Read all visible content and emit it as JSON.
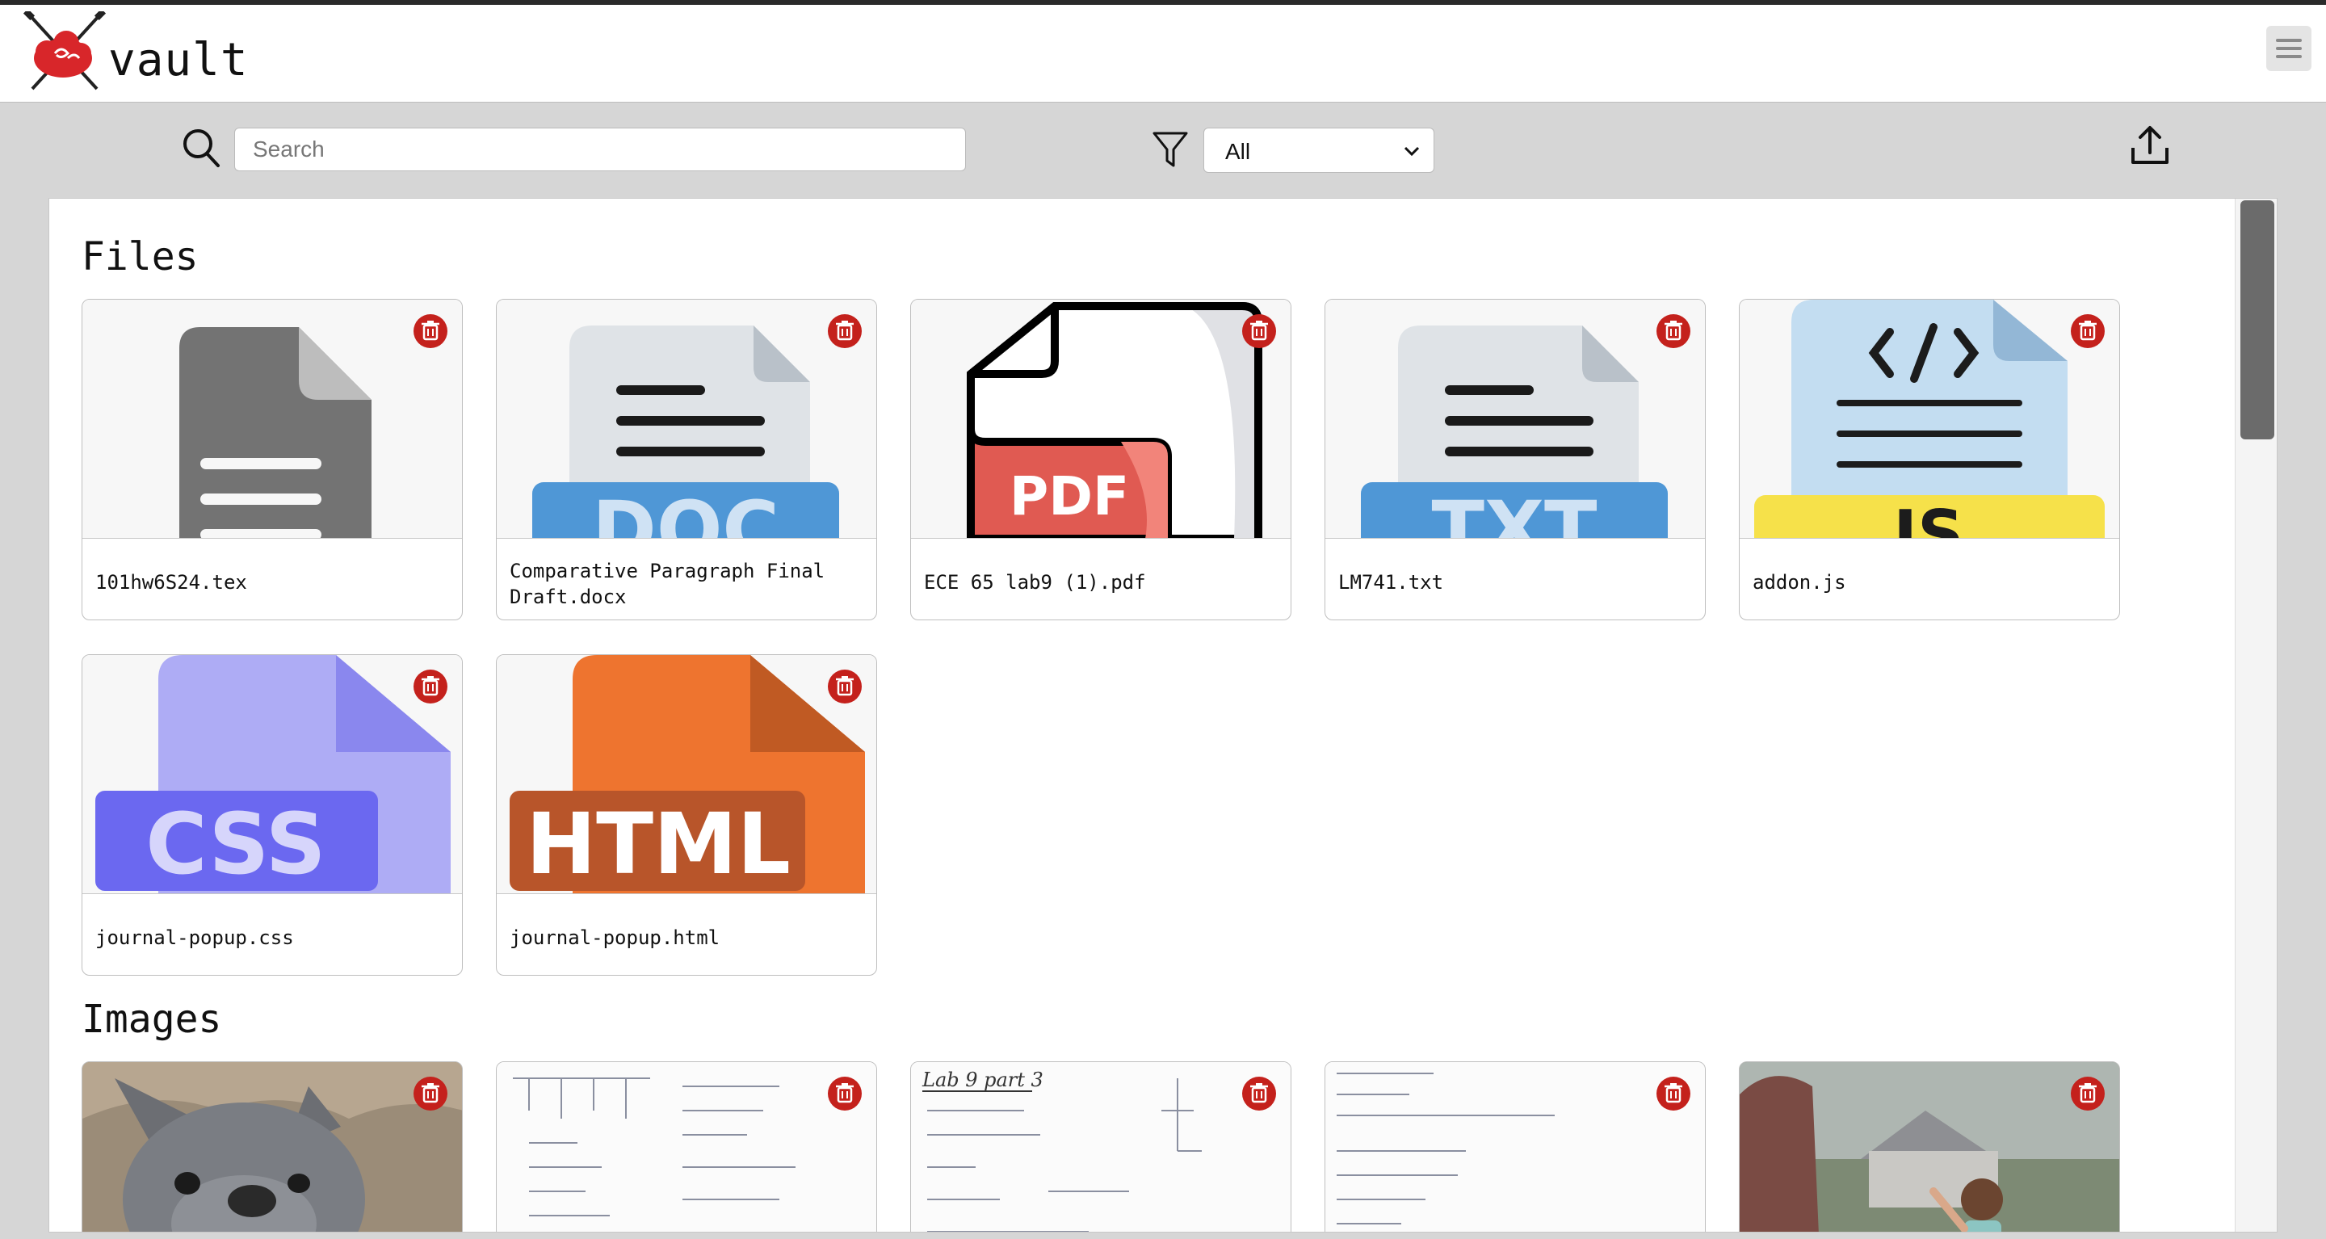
{
  "app": {
    "brand": "vault"
  },
  "toolbar": {
    "search_placeholder": "Search",
    "filter_value": "All",
    "filter_options": [
      "All"
    ]
  },
  "sections": {
    "files_title": "Files",
    "images_title": "Images"
  },
  "files": [
    {
      "name": "101hw6S24.tex",
      "kind": "tex-icon"
    },
    {
      "name": "Comparative Paragraph Final Draft.docx",
      "kind": "doc-icon",
      "label": "DOC"
    },
    {
      "name": "ECE 65 lab9 (1).pdf",
      "kind": "pdf-icon",
      "label": "PDF"
    },
    {
      "name": "LM741.txt",
      "kind": "txt-icon",
      "label": "TXT"
    },
    {
      "name": "addon.js",
      "kind": "js-icon",
      "label": "JS"
    },
    {
      "name": "journal-popup.css",
      "kind": "css-icon",
      "label": "CSS"
    },
    {
      "name": "journal-popup.html",
      "kind": "html-icon",
      "label": "HTML"
    }
  ],
  "images": [
    {
      "kind": "dog-photo"
    },
    {
      "kind": "handwritten-notes"
    },
    {
      "kind": "handwritten-notes",
      "heading": "Lab 9 part 3"
    },
    {
      "kind": "handwritten-notes"
    },
    {
      "kind": "outdoor-photo"
    }
  ],
  "colors": {
    "delete": "#c4211c",
    "doc": "#4f97d6",
    "pdf": "#e05a52",
    "js": "#f6e14a",
    "css": "#6b68f0",
    "html": "#e86f2c"
  }
}
